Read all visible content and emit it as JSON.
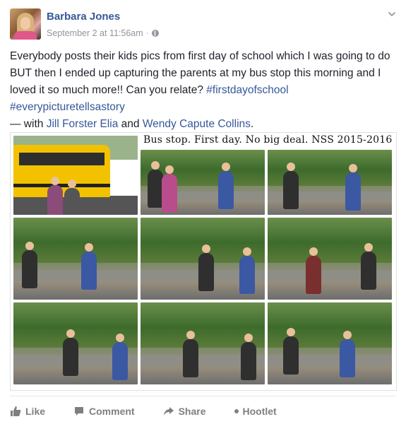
{
  "post": {
    "author": "Barbara Jones",
    "timestamp": "September 2 at 11:56am",
    "separator": " · ",
    "privacy_icon": "globe-icon",
    "menu_icon": "chevron-down-icon",
    "text_main": "Everybody posts their kids pics from first day of school which I was going to do BUT then I ended up capturing the parents at my bus stop this morning and I loved it so much more!! Can you relate? ",
    "hashtag_1": "#firstdayofschool",
    "hashtag_2": "#everypicturetellsastory",
    "with_prefix": "— with ",
    "tag_1": "Jill Forster Elia",
    "and_word": " and ",
    "tag_2": "Wendy Capute Collins",
    "period": "."
  },
  "photo": {
    "caption": "Bus stop. First day. No big deal.  NSS 2015-2016"
  },
  "actions": [
    {
      "label": "Like",
      "icon": "thumbs-up-icon"
    },
    {
      "label": "Comment",
      "icon": "comment-icon"
    },
    {
      "label": "Share",
      "icon": "share-icon"
    },
    {
      "label": "Hootlet",
      "icon": "dot-icon"
    }
  ],
  "colors": {
    "link": "#365899",
    "meta": "#90949c",
    "action": "#7f7f7f"
  }
}
